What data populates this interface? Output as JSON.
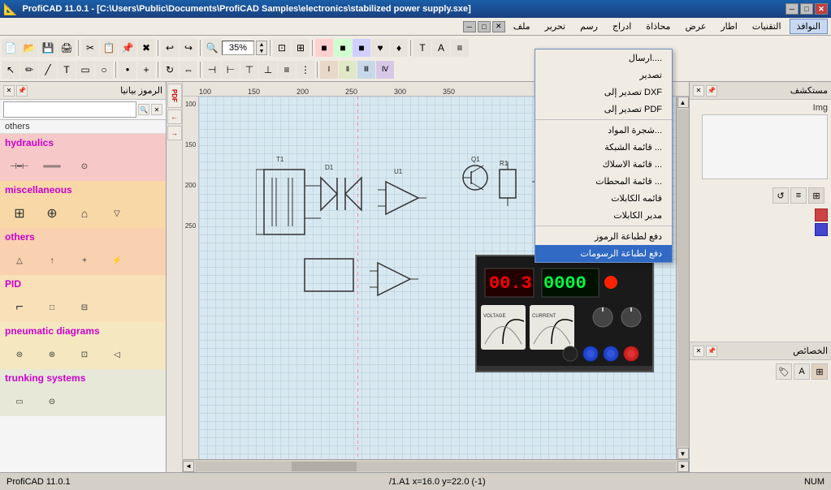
{
  "titleBar": {
    "title": "ProfiCAD 11.0.1 - [C:\\Users\\Public\\Documents\\ProfiCAD Samples\\electronics\\stabilized power supply.sxe]",
    "minBtn": "─",
    "maxBtn": "□",
    "closeBtn": "✕",
    "sysMinBtn": "─",
    "sysMaxBtn": "□",
    "sysCloseBtn": "✕"
  },
  "menuBar": {
    "items": [
      {
        "label": "التقنيات",
        "id": "techniques"
      },
      {
        "label": "اطار",
        "id": "frame"
      },
      {
        "label": "عرض",
        "id": "view"
      },
      {
        "label": "محاذاة",
        "id": "align"
      },
      {
        "label": "ادراج",
        "id": "insert"
      },
      {
        "label": "رسم",
        "id": "draw"
      },
      {
        "label": "تحرير",
        "id": "edit"
      },
      {
        "label": "ملف",
        "id": "file"
      },
      {
        "label": "النوافذ",
        "id": "windows",
        "active": true
      }
    ]
  },
  "dropdown": {
    "items": [
      {
        "label": "....ارسال",
        "id": "send"
      },
      {
        "label": "تصدير",
        "id": "export"
      },
      {
        "label": "DXF تصدير إلى",
        "id": "export-dxf"
      },
      {
        "label": "PDF تصدير إلى",
        "id": "export-pdf"
      },
      {
        "separator": true
      },
      {
        "label": "...شجرة المواد",
        "id": "tree"
      },
      {
        "label": "... قائمة الشبكة",
        "id": "network-list"
      },
      {
        "label": "... قائمة الاسلاك",
        "id": "wires-list"
      },
      {
        "label": "... قائمة المحطات",
        "id": "stations-list"
      },
      {
        "label": "قائمه الكابلات",
        "id": "cables-list"
      },
      {
        "label": "مدير الكابلات",
        "id": "cables-manager"
      },
      {
        "separator": true
      },
      {
        "label": "دفع لطباعة الرموز",
        "id": "print-symbols"
      },
      {
        "label": "دفع لطباعة الرسومات",
        "id": "print-drawings",
        "highlighted": true
      }
    ]
  },
  "leftPanel": {
    "header": "الرموز بيانيا",
    "searchPlaceholder": "",
    "tabs": [
      "بيانيا"
    ],
    "categories": [
      {
        "name": "others",
        "color": "cat-hydraulics",
        "categoryLabel": "hydraulics",
        "symbols": [
          "⊣",
          "═",
          "⊙"
        ]
      },
      {
        "name": "miscellaneous",
        "color": "cat-misc",
        "categoryLabel": "miscellaneous",
        "symbols": [
          "⊞",
          "⊕",
          "⌂",
          "▽"
        ]
      },
      {
        "name": "others2",
        "color": "cat-others",
        "categoryLabel": "others",
        "symbols": [
          "△",
          "↑",
          "+",
          "⚡"
        ]
      },
      {
        "name": "pid",
        "color": "cat-pid",
        "categoryLabel": "PID",
        "symbols": [
          "⌐",
          "□",
          "⊟"
        ]
      },
      {
        "name": "pneumatic",
        "color": "cat-pneumatic",
        "categoryLabel": "pneumatic diagrams",
        "symbols": [
          "⊜",
          "⊛",
          "⊡",
          "◁"
        ]
      },
      {
        "name": "trunking",
        "color": "cat-trunking",
        "categoryLabel": "trunking systems",
        "symbols": [
          "▭",
          "⊝"
        ]
      }
    ]
  },
  "rightPanel": {
    "topHeader": "مستكشف",
    "imgLabel": "Img",
    "bottomHeader": "الخصائص"
  },
  "canvas": {
    "zoom": "35%",
    "rulerMarks": [
      "100",
      "150",
      "200",
      "250",
      "300",
      "350"
    ],
    "rulerMarksV": [
      "100",
      "150",
      "200",
      "250"
    ],
    "scrollH": 30,
    "scrollV": 20
  },
  "statusBar": {
    "left": "ProfiCAD 11.0.1",
    "coord": "/1.A1  x=16.0  y=22.0 (-1)",
    "mode": "NUM"
  },
  "toolbar": {
    "zoomValue": "35%"
  }
}
